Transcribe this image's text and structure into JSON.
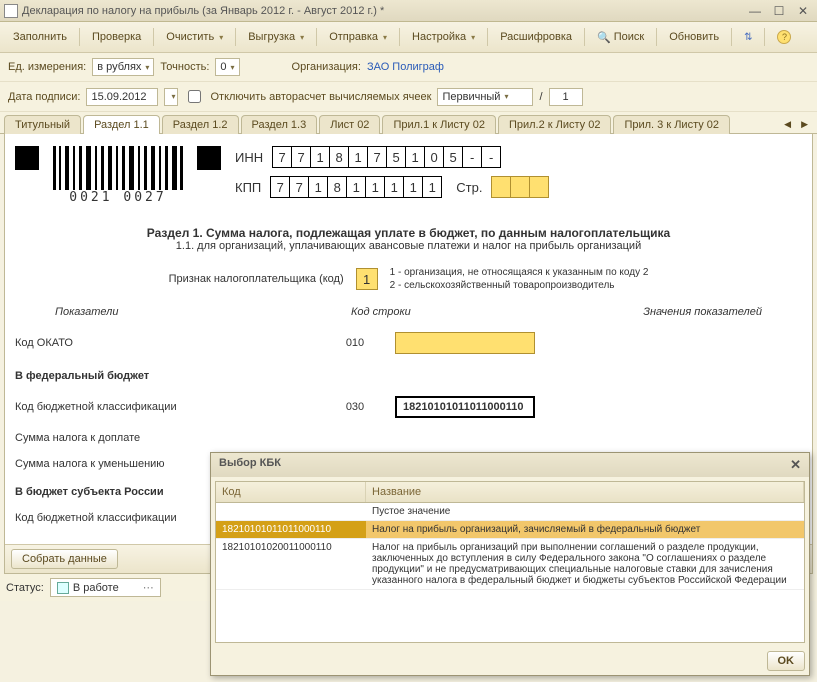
{
  "window": {
    "title": "Декларация по налогу на прибыль (за Январь 2012 г. - Август 2012 г.) *"
  },
  "toolbar": {
    "fill": "Заполнить",
    "check": "Проверка",
    "clear": "Очистить",
    "export": "Выгрузка",
    "send": "Отправка",
    "settings": "Настройка",
    "explain": "Расшифровка",
    "search": "Поиск",
    "refresh": "Обновить"
  },
  "params": {
    "unit_label": "Ед. измерения:",
    "unit_value": "в рублях",
    "precision_label": "Точность:",
    "precision_value": "0",
    "org_label": "Организация:",
    "org_value": "ЗАО Полиграф",
    "sign_date_label": "Дата подписи:",
    "sign_date_value": "15.09.2012",
    "autocalc_label": "Отключить авторасчет вычисляемых ячеек",
    "doc_type": "Первичный",
    "slash": "/",
    "page_num": "1"
  },
  "tabs": [
    "Титульный",
    "Раздел 1.1",
    "Раздел 1.2",
    "Раздел 1.3",
    "Лист 02",
    "Прил.1 к Листу 02",
    "Прил.2 к Листу 02",
    "Прил. 3 к Листу 02"
  ],
  "active_tab": 1,
  "page": {
    "barcode_text": "0021 0027",
    "inn_label": "ИНН",
    "inn_cells": [
      "7",
      "7",
      "1",
      "8",
      "1",
      "7",
      "5",
      "1",
      "0",
      "5",
      "-",
      "-"
    ],
    "kpp_label": "КПП",
    "kpp_cells": [
      "7",
      "7",
      "1",
      "8",
      "1",
      "1",
      "1",
      "1",
      "1"
    ],
    "page_label": "Стр.",
    "page_cells": [
      "",
      "",
      ""
    ],
    "heading_bold": "Раздел 1. Сумма налога, подлежащая уплате в бюджет, по данным налогоплательщика",
    "heading_sub": "1.1. для организаций, уплачивающих авансовые платежи и налог на прибыль организаций",
    "sign_label": "Признак налогоплательщика (код)",
    "sign_value": "1",
    "sign_legend1": "1 - организация, не относящаяся к указанным по коду 2",
    "sign_legend2": "2 - сельскохозяйственный товаропроизводитель",
    "col_ind": "Показатели",
    "col_code": "Код строки",
    "col_val": "Значения показателей",
    "rows": [
      {
        "lbl": "Код ОКАТО",
        "code": "010",
        "value": "",
        "kind": "yellow"
      },
      {
        "lbl_bold": "В федеральный бюджет",
        "lbl": "Код бюджетной классификации",
        "code": "030",
        "value": "18210101011011000110",
        "kind": "white"
      },
      {
        "lbl": "Сумма налога к доплате",
        "code": "",
        "value": "",
        "kind": "none"
      },
      {
        "lbl": "Сумма налога к уменьшению",
        "code": "",
        "value": "",
        "kind": "none"
      },
      {
        "lbl_bold": "В бюджет субъекта России",
        "lbl": "Код бюджетной классификации",
        "code": "",
        "value": "",
        "kind": "cut"
      }
    ],
    "collect_btn": "Собрать данные"
  },
  "status": {
    "label": "Статус:",
    "value": "В работе"
  },
  "modal": {
    "title": "Выбор КБК",
    "col_code": "Код",
    "col_name": "Название",
    "rows": [
      {
        "code": "",
        "name": "Пустое значение"
      },
      {
        "code": "18210101011011000110",
        "name": "Налог на прибыль организаций, зачисляемый в федеральный бюджет"
      },
      {
        "code": "18210101020011000110",
        "name": "Налог на прибыль организаций при выполнении соглашений о разделе продукции, заключенных до вступления в силу Федерального закона \"О соглашениях о разделе продукции\" и не предусматривающих специальные налоговые ставки для зачисления указанного налога в федеральный бюджет и бюджеты субъектов Российской Федерации"
      }
    ],
    "selected_index": 1,
    "ok": "OK"
  }
}
